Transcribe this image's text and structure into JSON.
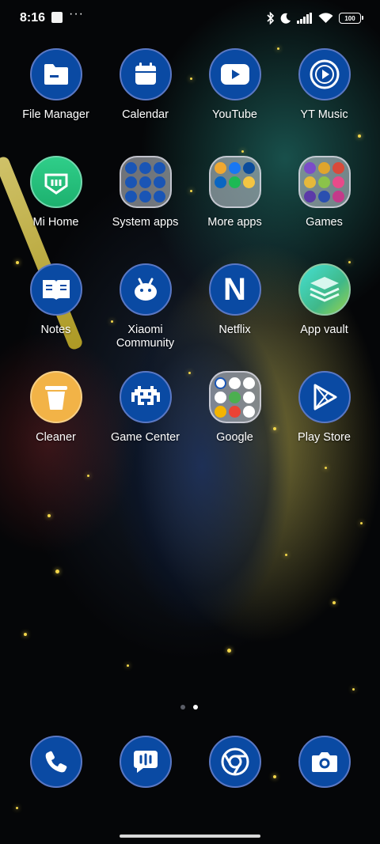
{
  "status_bar": {
    "time": "8:16",
    "notification_icons": [
      "screenshot-notification-icon",
      "more-notifications-icon"
    ],
    "system_icons": [
      "bluetooth-icon",
      "do-not-disturb-icon",
      "signal-icon",
      "wifi-icon"
    ],
    "battery": "100"
  },
  "apps": [
    {
      "label": "File Manager",
      "icon": "folder-icon"
    },
    {
      "label": "Calendar",
      "icon": "calendar-icon"
    },
    {
      "label": "YouTube",
      "icon": "youtube-icon"
    },
    {
      "label": "YT Music",
      "icon": "yt-music-icon"
    },
    {
      "label": "Mi Home",
      "icon": "mi-home-icon"
    },
    {
      "label": "System apps",
      "icon": "folder-system-apps-icon"
    },
    {
      "label": "More apps",
      "icon": "folder-more-apps-icon"
    },
    {
      "label": "Games",
      "icon": "folder-games-icon"
    },
    {
      "label": "Notes",
      "icon": "notes-icon"
    },
    {
      "label": "Xiaomi Community",
      "icon": "xiaomi-community-icon"
    },
    {
      "label": "Netflix",
      "icon": "netflix-icon",
      "glyph": "N"
    },
    {
      "label": "App vault",
      "icon": "app-vault-icon"
    },
    {
      "label": "Cleaner",
      "icon": "cleaner-icon"
    },
    {
      "label": "Game Center",
      "icon": "game-center-icon"
    },
    {
      "label": "Google",
      "icon": "folder-google-icon"
    },
    {
      "label": "Play Store",
      "icon": "play-store-icon"
    }
  ],
  "page_indicator": {
    "pages": 2,
    "current": 2
  },
  "dock": [
    {
      "name": "Phone",
      "icon": "phone-icon"
    },
    {
      "name": "Messaging",
      "icon": "messaging-icon"
    },
    {
      "name": "Chrome",
      "icon": "chrome-icon"
    },
    {
      "name": "Camera",
      "icon": "camera-icon"
    }
  ],
  "colors": {
    "icon_fill": "#0a4aa3",
    "icon_ring": "#5a78c4",
    "accent_gold": "#f2d64a"
  }
}
